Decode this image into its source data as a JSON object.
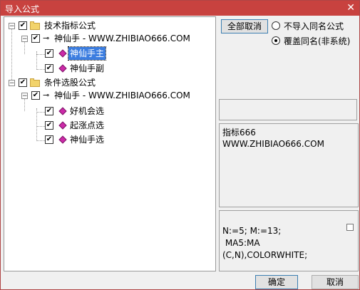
{
  "window": {
    "title": "导入公式",
    "close_glyph": "✕"
  },
  "tree": {
    "groups": [
      {
        "label": "技术指标公式",
        "source": "神仙手 - WWW.ZHIBIAO666.COM",
        "items": [
          "神仙手主",
          "神仙手副"
        ],
        "selected_item": "神仙手主"
      },
      {
        "label": "条件选股公式",
        "source": "神仙手 - WWW.ZHIBIAO666.COM",
        "items": [
          "好机会选",
          "起涨点选",
          "神仙手选"
        ]
      }
    ]
  },
  "buttons": {
    "deselect_all": "全部取消",
    "ok": "确定",
    "cancel": "取消"
  },
  "options": {
    "skip_same_name": "不导入同名公式",
    "overwrite_same_name": "覆盖同名(非系统)",
    "selected": "overwrite_same_name"
  },
  "info": {
    "line1": "指标666",
    "line2": "WWW.ZHIBIAO666.COM"
  },
  "formula": {
    "line1": "N:=5; M:=13;",
    "line2": " MA5:MA",
    "line3": "(C,N),COLORWHITE;"
  }
}
